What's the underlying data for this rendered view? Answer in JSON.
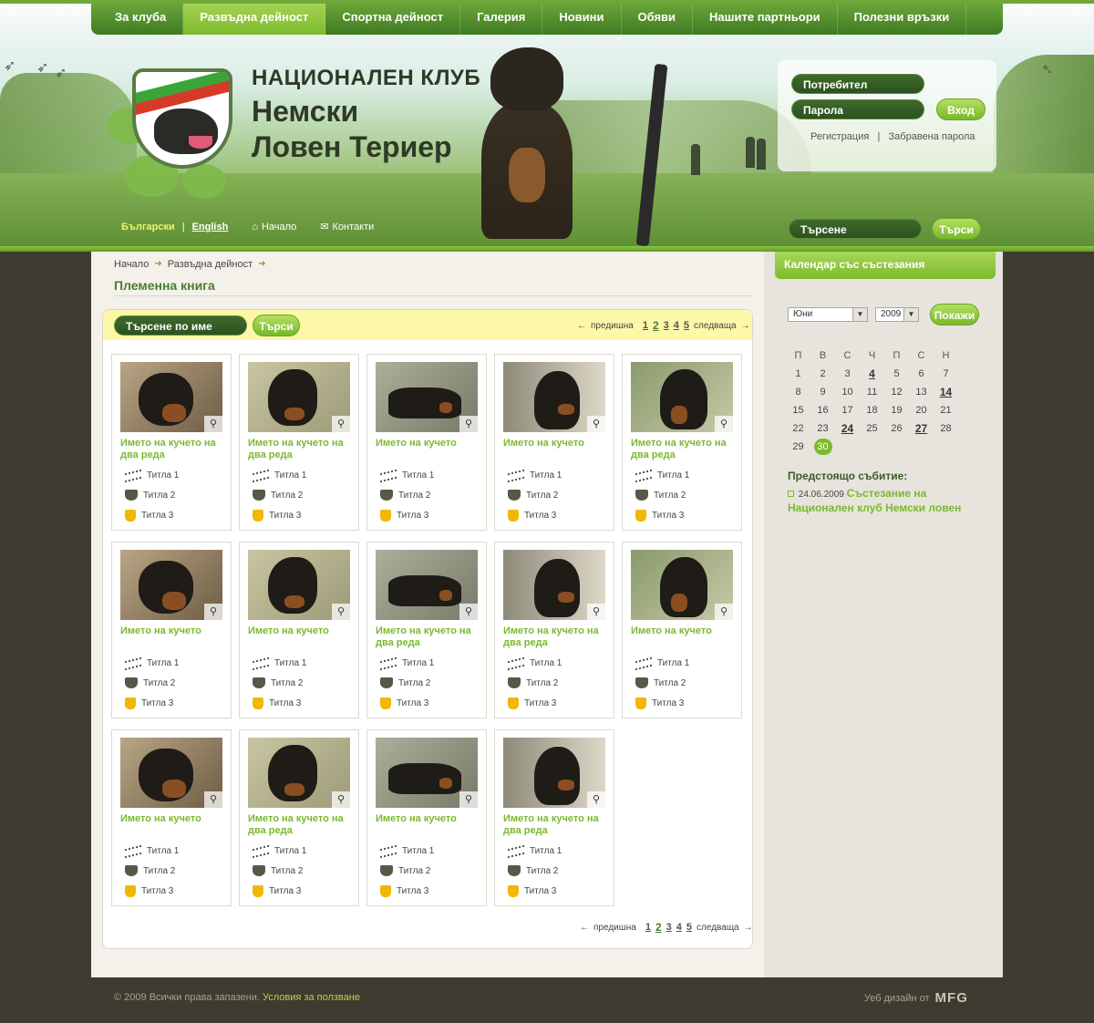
{
  "nav": {
    "items": [
      "За клуба",
      "Развъдна дейност",
      "Спортна дейност",
      "Галерия",
      "Новини",
      "Обяви",
      "Нашите партньори",
      "Полезни връзки"
    ],
    "active_index": 1
  },
  "logo": {
    "line1": "НАЦИОНАЛЕН КЛУБ",
    "line2": "Немски",
    "line3": "Ловен Териер"
  },
  "login": {
    "user_placeholder": "Потребител",
    "pass_placeholder": "Парола",
    "submit_label": "Вход",
    "register_link": "Регистрация",
    "separator": "|",
    "forgot_link": "Забравена парола"
  },
  "langbar": {
    "bulgarian": "Български",
    "separator": "|",
    "english": "English",
    "home": "Начало",
    "contacts": "Контакти"
  },
  "top_search": {
    "placeholder": "Търсене",
    "button": "Търси"
  },
  "breadcrumb": [
    "Начало",
    "Развъдна дейност"
  ],
  "page_title": "Племенна книга",
  "name_search": {
    "placeholder": "Търсене по име",
    "button": "Търси"
  },
  "pager": {
    "prev": "предишна",
    "next": "следваща",
    "pages": [
      "1",
      "2",
      "3",
      "4",
      "5"
    ],
    "current": "2"
  },
  "cards": [
    {
      "name": "Името на кучето на два реда"
    },
    {
      "name": "Името на кучето на два реда"
    },
    {
      "name": "Името на кучето"
    },
    {
      "name": "Името на кучето"
    },
    {
      "name": "Името на кучето на два реда"
    },
    {
      "name": "Името на кучето"
    },
    {
      "name": "Името на кучето"
    },
    {
      "name": "Името на кучето на два реда"
    },
    {
      "name": "Името на кучето на два реда"
    },
    {
      "name": "Името на кучето"
    },
    {
      "name": "Името на кучето"
    },
    {
      "name": "Името на кучето на два реда"
    },
    {
      "name": "Името на кучето"
    },
    {
      "name": "Името на кучето на два реда"
    }
  ],
  "card_titles": [
    "Титла 1",
    "Титла 2",
    "Титла 3"
  ],
  "calendar": {
    "header": "Календар със състезания",
    "month": "Юни",
    "year": "2009",
    "show_button": "Покажи",
    "weekdays": [
      "П",
      "В",
      "С",
      "Ч",
      "П",
      "С",
      "Н"
    ],
    "weeks": [
      [
        "1",
        "2",
        "3",
        "4",
        "5",
        "6",
        "7"
      ],
      [
        "8",
        "9",
        "10",
        "11",
        "12",
        "13",
        "14"
      ],
      [
        "15",
        "16",
        "17",
        "18",
        "19",
        "20",
        "21"
      ],
      [
        "22",
        "23",
        "24",
        "25",
        "26",
        "27",
        "28"
      ],
      [
        "29",
        "30",
        "",
        "",
        "",
        "",
        ""
      ]
    ],
    "event_days": [
      "4",
      "14",
      "24",
      "27"
    ],
    "today": "30"
  },
  "upcoming": {
    "heading": "Предстоящо събитие:",
    "date": "24.06.2009",
    "title": "Състезание на Национален клуб Немски ловен"
  },
  "footer": {
    "copyright": "© 2009 Всички права запазени.",
    "terms": "Условия за ползване",
    "design": "Уеб дизайн  от",
    "designer": "MFG"
  },
  "colors": {
    "accent_green": "#7bbb2b",
    "nav_green": "#3f7a23",
    "search_yellow": "#fcf8a8",
    "footer_bg": "#3e3b30"
  }
}
